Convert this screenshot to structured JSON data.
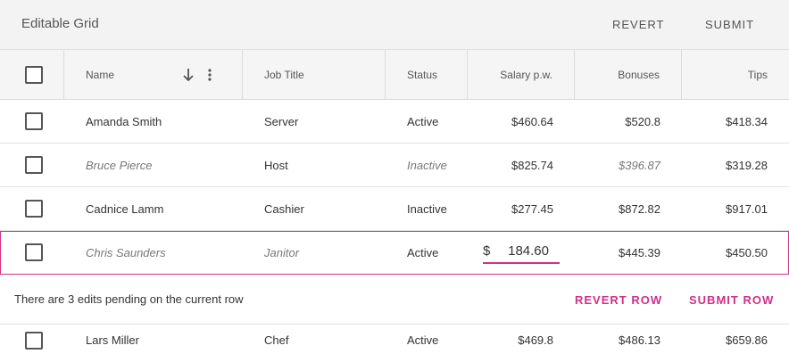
{
  "toolbar": {
    "title": "Editable Grid",
    "revert_label": "REVERT",
    "submit_label": "SUBMIT"
  },
  "columns": [
    "Name",
    "Job Title",
    "Status",
    "Salary p.w.",
    "Bonuses",
    "Tips"
  ],
  "header_icons": [
    "arrow-down-icon",
    "more-vert-icon"
  ],
  "rows": [
    {
      "name": "Amanda Smith",
      "job": "Server",
      "status": "Active",
      "salary": "$460.64",
      "bonuses": "$520.8",
      "tips": "$418.34"
    },
    {
      "name": "Bruce Pierce",
      "job": "Host",
      "status": "Inactive",
      "salary": "$825.74",
      "bonuses": "$396.87",
      "tips": "$319.28"
    },
    {
      "name": "Cadnice Lamm",
      "job": "Cashier",
      "status": "Inactive",
      "salary": "$277.45",
      "bonuses": "$872.82",
      "tips": "$917.01"
    },
    {
      "name": "Chris Saunders",
      "job": "Janitor",
      "status": "Active",
      "salary_symbol": "$",
      "salary_value": "184.60",
      "bonuses": "$445.39",
      "tips": "$450.50"
    },
    {
      "name": "Lars Miller",
      "job": "Chef",
      "status": "Active",
      "salary": "$469.8",
      "bonuses": "$486.13",
      "tips": "$659.86"
    }
  ],
  "pending": {
    "message": "There are 3 edits pending on the current row",
    "revert_row_label": "REVERT ROW",
    "submit_row_label": "SUBMIT ROW"
  },
  "colors": {
    "accent": "#d0308a",
    "toolbar_bg": "#f3f3f3",
    "header_bg": "#f5f5f5"
  }
}
